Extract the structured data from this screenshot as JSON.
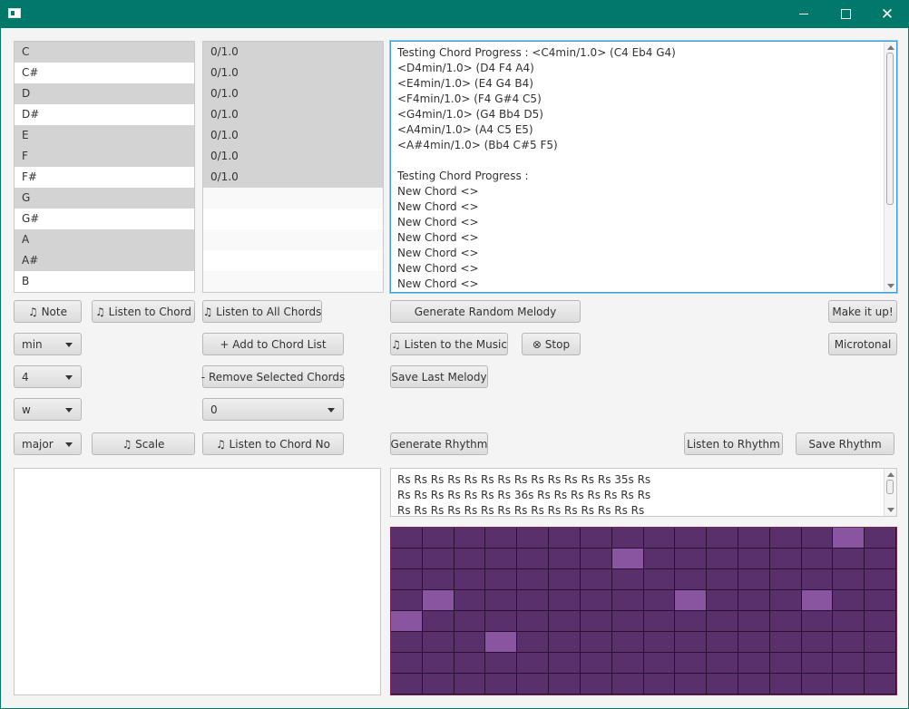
{
  "window": {
    "title": ""
  },
  "notes": [
    "C",
    "C#",
    "D",
    "D#",
    "E",
    "F",
    "F#",
    "G",
    "G#",
    "A",
    "A#",
    "B"
  ],
  "note_highlight": [
    true,
    false,
    true,
    false,
    true,
    true,
    false,
    true,
    false,
    true,
    true,
    false
  ],
  "durations": [
    "0/1.0",
    "0/1.0",
    "0/1.0",
    "0/1.0",
    "0/1.0",
    "0/1.0",
    "0/1.0"
  ],
  "buttons": {
    "note": "♫ Note",
    "listen_chord": "♫ Listen to Chord",
    "listen_all": "♫ Listen to All Chords",
    "generate_melody": "Generate Random Melody",
    "make_it_up": "Make it up!",
    "add_chord": "+ Add to Chord List",
    "listen_music": "♫ Listen to the Music",
    "stop": "⊗ Stop",
    "microtonal": "Microtonal",
    "remove_chords": "- Remove Selected Chords",
    "save_melody": "Save Last Melody",
    "scale": "♫ Scale",
    "listen_chord_no": "♫ Listen to Chord No",
    "generate_rhythm": "Generate Rhythm",
    "listen_rhythm": "Listen to Rhythm",
    "save_rhythm": "Save Rhythm"
  },
  "combos": {
    "chord_type": "min",
    "octave": "4",
    "duration": "w",
    "chord_no": "0",
    "scale_type": "major"
  },
  "progress_text": [
    "Testing Chord Progress : <C4min/1.0> (C4 Eb4 G4)",
    "<D4min/1.0> (D4 F4 A4)",
    "<E4min/1.0> (E4 G4 B4)",
    "<F4min/1.0> (F4 G#4 C5)",
    "<G4min/1.0> (G4 Bb4 D5)",
    "<A4min/1.0> (A4 C5 E5)",
    "<A#4min/1.0> (Bb4 C#5 F5)",
    "",
    "Testing Chord Progress :",
    "New Chord <>",
    "New Chord <>",
    "New Chord <>",
    "New Chord <>",
    "New Chord <>",
    "New Chord <>",
    "New Chord <>"
  ],
  "rhythm_text": [
    "Rs Rs Rs Rs Rs Rs Rs Rs Rs Rs Rs Rs Rs 35s Rs",
    "Rs Rs Rs Rs Rs Rs Rs 36s Rs Rs Rs Rs Rs Rs Rs",
    "Rs Rs Rs Rs Rs Rs Rs Rs Rs Rs Rs Rs Rs Rs Rs"
  ],
  "grid": {
    "rows": 8,
    "cols": 16,
    "active": [
      [
        0,
        14
      ],
      [
        1,
        7
      ],
      [
        3,
        1
      ],
      [
        3,
        9
      ],
      [
        3,
        13
      ],
      [
        4,
        0
      ],
      [
        5,
        3
      ]
    ],
    "cell_color": "#59306b",
    "active_color": "#8a55a0"
  }
}
